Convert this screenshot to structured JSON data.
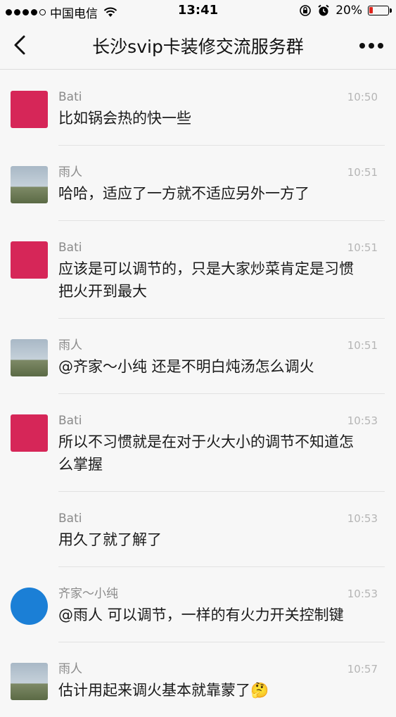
{
  "status": {
    "carrier": "中国电信",
    "time": "13:41",
    "battery": "20%",
    "battery_level": 0.2,
    "battery_color": "#e0241c"
  },
  "nav": {
    "title": "长沙svip卡装修交流服务群"
  },
  "messages": [
    {
      "sender": "Bati",
      "time": "10:50",
      "text": "比如锅会热的快一些",
      "avatar": "bati"
    },
    {
      "sender": "雨人",
      "time": "10:51",
      "text": "哈哈，适应了一方就不适应另外一方了",
      "avatar": "rain"
    },
    {
      "sender": "Bati",
      "time": "10:51",
      "text": "应该是可以调节的，只是大家炒菜肯定是习惯把火开到最大",
      "avatar": "bati"
    },
    {
      "sender": "雨人",
      "time": "10:51",
      "text": "@齐家～小纯 还是不明白炖汤怎么调火",
      "avatar": "rain"
    },
    {
      "sender": "Bati",
      "time": "10:53",
      "text": "所以不习惯就是在对于火大小的调节不知道怎么掌握",
      "avatar": "bati"
    },
    {
      "sender": "Bati",
      "time": "10:53",
      "text": "用久了就了解了",
      "avatar": "none"
    },
    {
      "sender": "齐家～小纯",
      "time": "10:53",
      "text": "@雨人 可以调节，一样的有火力开关控制键",
      "avatar": "qj"
    },
    {
      "sender": "雨人",
      "time": "10:57",
      "text": "估计用起来调火基本就靠蒙了🤔",
      "avatar": "rain"
    }
  ]
}
